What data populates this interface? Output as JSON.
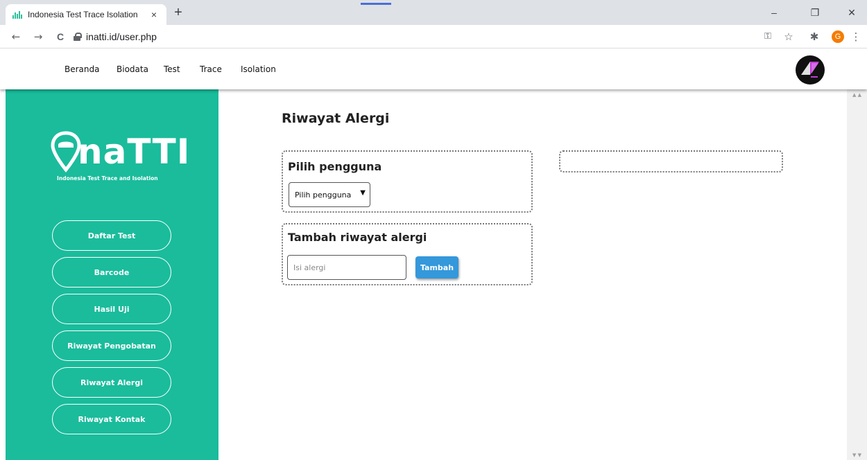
{
  "browser": {
    "tab_title": "Indonesia Test Trace Isolation",
    "tab_close": "×",
    "new_tab": "+",
    "url": "inatti.id/user.php",
    "profile_initial": "G",
    "window_buttons": {
      "minimize": "–",
      "restore": "❐",
      "close": "✕"
    },
    "toolbar_icons": {
      "back": "←",
      "forward": "→",
      "reload": "C",
      "key": "⚿",
      "star": "☆",
      "puzzle": "✱",
      "menu": "⋮"
    }
  },
  "nav": {
    "links": [
      "Beranda",
      "Biodata",
      "Test",
      "Trace",
      "Isolation"
    ]
  },
  "sidebar": {
    "logo_text": "naTTI",
    "logo_subtitle": "Indonesia Test Trace and Isolation",
    "items": [
      "Daftar Test",
      "Barcode",
      "Hasil Uji",
      "Riwayat Pengobatan",
      "Riwayat Alergi",
      "Riwayat Kontak"
    ]
  },
  "main": {
    "title": "Riwayat Alergi",
    "select_card": {
      "heading": "Pilih pengguna",
      "select_value": "Pilih pengguna"
    },
    "add_card": {
      "heading": "Tambah riwayat alergi",
      "input_placeholder": "Isi alergi",
      "button_label": "Tambah"
    }
  },
  "colors": {
    "sidebar": "#1abc9c",
    "button_blue": "#3498db",
    "profile": "#f57c00"
  }
}
